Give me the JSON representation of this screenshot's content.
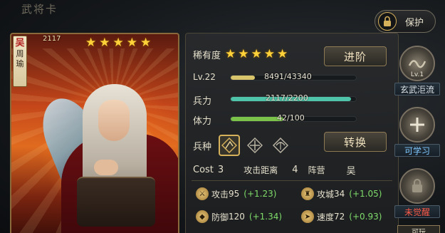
{
  "page_title": "武将卡",
  "card": {
    "faction": "吴",
    "name": "周瑜",
    "id": "2117",
    "star_count": 5,
    "stars": [
      "★",
      "★",
      "★",
      "★",
      "★"
    ]
  },
  "info": {
    "rarity_label": "稀有度",
    "rarity_stars": [
      "★",
      "★",
      "★",
      "★",
      "★"
    ],
    "advance_button": "进阶",
    "level": {
      "label": "Lv.22",
      "value_text": "8491/43340",
      "current": 8491,
      "max": 43340
    },
    "troops": {
      "label": "兵力",
      "value_text": "2117/2200",
      "current": 2117,
      "max": 2200
    },
    "stamina": {
      "label": "体力",
      "value_text": "42/100",
      "current": 42,
      "max": 100
    },
    "unit_type_label": "兵种",
    "unit_types": [
      {
        "icon": "cavalry-icon",
        "selected": true
      },
      {
        "icon": "infantry-icon",
        "selected": false
      },
      {
        "icon": "archer-icon",
        "selected": false
      }
    ],
    "convert_button": "转换",
    "cost_label": "Cost",
    "cost_value": "3",
    "range_label": "攻击距离",
    "range_value": "4",
    "camp_label": "阵营",
    "camp_value": "吴",
    "stats": {
      "attack": {
        "label": "攻击",
        "value": "95",
        "bonus": "(+1.23)"
      },
      "siege": {
        "label": "攻城",
        "value": "34",
        "bonus": "(+1.05)"
      },
      "defense": {
        "label": "防御",
        "value": "120",
        "bonus": "(+1.34)"
      },
      "speed": {
        "label": "速度",
        "value": "72",
        "bonus": "(+0.93)"
      }
    }
  },
  "protect_button": "保护",
  "skills": [
    {
      "label": "玄武洰流",
      "level": "Lv.1",
      "state": "learned"
    },
    {
      "label": "可学习",
      "state": "learnable"
    },
    {
      "label": "未觉醒",
      "state": "unawakened"
    }
  ],
  "bottom_tag": "可玩",
  "colors": {
    "level_bar": "#d8c46a",
    "troop_bar": "#4fc4a8",
    "stamina_bar": "#7ac24a",
    "star": "#ffd23a",
    "bonus": "#7fdc6a",
    "unawakened": "#ff5a48"
  }
}
